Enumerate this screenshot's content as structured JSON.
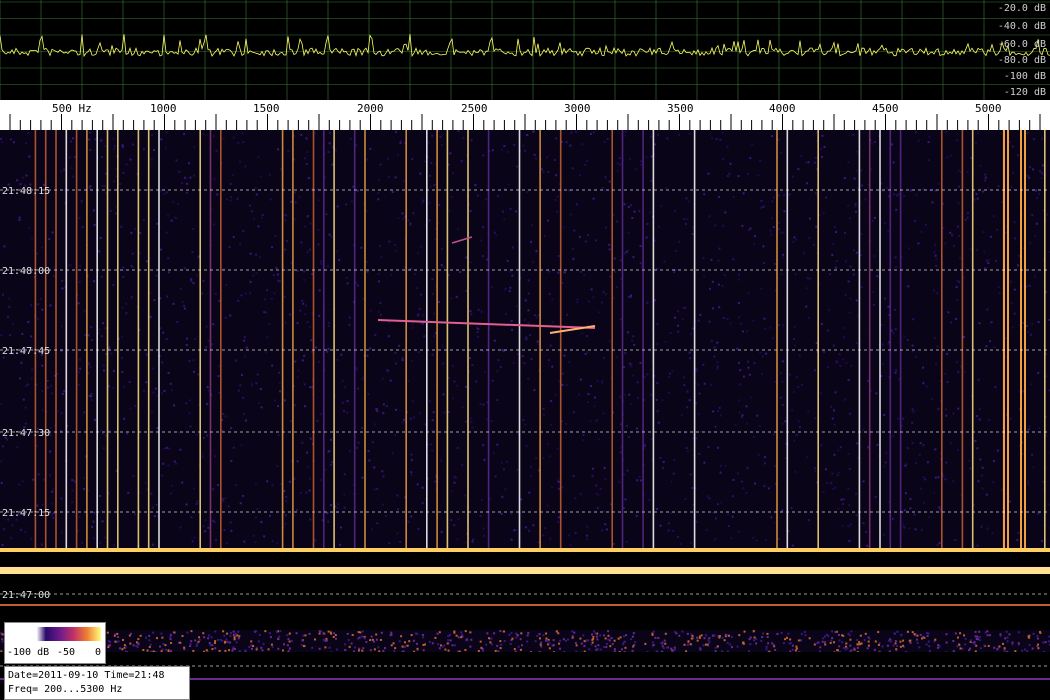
{
  "spectrum": {
    "db_labels": [
      "-20.0 dB",
      "-40.0 dB",
      "-60.0 dB",
      "-80.0 dB",
      "-100 dB",
      "-120 dB"
    ]
  },
  "freq_axis": {
    "labels": [
      "500 Hz",
      "1000",
      "1500",
      "2000",
      "2500",
      "3000",
      "3500",
      "4000",
      "4500",
      "5000"
    ]
  },
  "waterfall": {
    "time_labels": [
      "21:48:15",
      "21:48:00",
      "21:47:45",
      "21:47:30",
      "21:47:15",
      "21:47:00"
    ]
  },
  "colorbar": {
    "min_label": "-100 dB",
    "mid_label": "-50",
    "max_label": "0"
  },
  "info": {
    "date_line": "Date=2011-09-10 Time=21:48",
    "freq_line": "Freq= 200...5300 Hz"
  },
  "colors": {
    "trace": "#ffff60",
    "grid": "#3a7a3a",
    "background": "#000000",
    "waterfall_bg": "#0a0418"
  }
}
